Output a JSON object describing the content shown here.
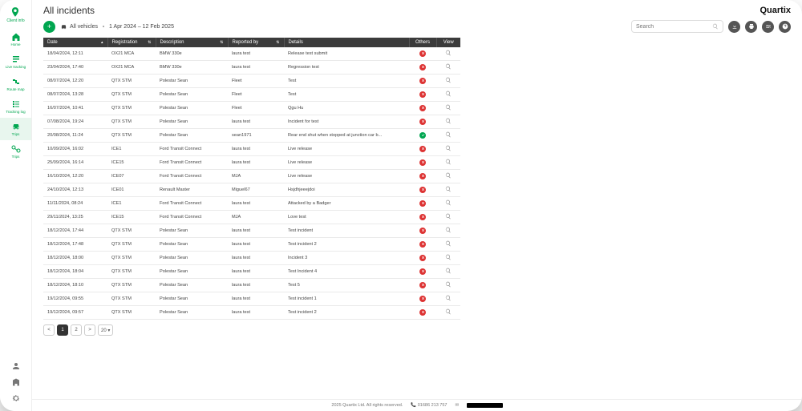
{
  "brand": "Quartix",
  "page_title": "All incidents",
  "sidebar": {
    "client_info": "Client info",
    "items": [
      {
        "label": "Home"
      },
      {
        "label": "Live tracking"
      },
      {
        "label": "Route map"
      },
      {
        "label": "Tracking log"
      },
      {
        "label": "Trips"
      },
      {
        "label": "Trips"
      }
    ]
  },
  "toolbar": {
    "vehicle_filter": "All vehicles",
    "date_range": "1 Apr 2024 – 12 Feb 2025",
    "search_placeholder": "Search"
  },
  "table": {
    "headers": {
      "date": "Date",
      "registration": "Registration",
      "description": "Description",
      "reported_by": "Reported by",
      "details": "Details",
      "others": "Others",
      "view": "View"
    },
    "rows": [
      {
        "date": "18/04/2024, 12:11",
        "reg": "OX21 MCA",
        "desc": "BMW 330e",
        "rep": "laura test",
        "det": "Release test submit",
        "status": "red"
      },
      {
        "date": "23/04/2024, 17:40",
        "reg": "OX21 MCA",
        "desc": "BMW 330e",
        "rep": "laura test",
        "det": "Regression test",
        "status": "red"
      },
      {
        "date": "08/07/2024, 12:20",
        "reg": "QTX STM",
        "desc": "Polestar Sean",
        "rep": "Fleet",
        "det": "Test",
        "status": "red"
      },
      {
        "date": "08/07/2024, 13:28",
        "reg": "QTX STM",
        "desc": "Polestar Sean",
        "rep": "Fleet",
        "det": "Test",
        "status": "red"
      },
      {
        "date": "16/07/2024, 10:41",
        "reg": "QTX STM",
        "desc": "Polestar Sean",
        "rep": "Fleet",
        "det": "Qgu Hu",
        "status": "red"
      },
      {
        "date": "07/08/2024, 19:24",
        "reg": "QTX STM",
        "desc": "Polestar Sean",
        "rep": "laura test",
        "det": "Incident for test",
        "status": "red"
      },
      {
        "date": "20/08/2024, 11:24",
        "reg": "QTX STM",
        "desc": "Polestar Sean",
        "rep": "sean1971",
        "det": "Rear end shut when stopped at junction car b...",
        "status": "green"
      },
      {
        "date": "10/09/2024, 16:02",
        "reg": "ICE1",
        "desc": "Ford Transit Connect",
        "rep": "laura test",
        "det": "Live release",
        "status": "red"
      },
      {
        "date": "25/09/2024, 16:14",
        "reg": "ICE15",
        "desc": "Ford Transit Connect",
        "rep": "laura test",
        "det": "Live release",
        "status": "red"
      },
      {
        "date": "16/10/2024, 12:20",
        "reg": "ICE07",
        "desc": "Ford Transit Connect",
        "rep": "MJA",
        "det": "Live release",
        "status": "red"
      },
      {
        "date": "24/10/2024, 12:13",
        "reg": "ICE01",
        "desc": "Renault Master",
        "rep": "Miguel67",
        "det": "Hsjdhjeeejdoi",
        "status": "red"
      },
      {
        "date": "11/11/2024, 08:24",
        "reg": "ICE1",
        "desc": "Ford Transit Connect",
        "rep": "laura test",
        "det": "Attacked by a Badger",
        "status": "red"
      },
      {
        "date": "29/11/2024, 13:25",
        "reg": "ICE15",
        "desc": "Ford Transit Connect",
        "rep": "MJA",
        "det": "Love test",
        "status": "red"
      },
      {
        "date": "18/12/2024, 17:44",
        "reg": "QTX STM",
        "desc": "Polestar Sean",
        "rep": "laura test",
        "det": "Test incident",
        "status": "red"
      },
      {
        "date": "18/12/2024, 17:48",
        "reg": "QTX STM",
        "desc": "Polestar Sean",
        "rep": "laura test",
        "det": "Test incident 2",
        "status": "red"
      },
      {
        "date": "18/12/2024, 18:00",
        "reg": "QTX STM",
        "desc": "Polestar Sean",
        "rep": "laura test",
        "det": "Incident 3",
        "status": "red"
      },
      {
        "date": "18/12/2024, 18:04",
        "reg": "QTX STM",
        "desc": "Polestar Sean",
        "rep": "laura test",
        "det": "Test Incident 4",
        "status": "red"
      },
      {
        "date": "18/12/2024, 18:10",
        "reg": "QTX STM",
        "desc": "Polestar Sean",
        "rep": "laura test",
        "det": "Test 5",
        "status": "red"
      },
      {
        "date": "19/12/2024, 09:55",
        "reg": "QTX STM",
        "desc": "Polestar Sean",
        "rep": "laura test",
        "det": "Test incident 1",
        "status": "red"
      },
      {
        "date": "19/12/2024, 09:57",
        "reg": "QTX STM",
        "desc": "Polestar Sean",
        "rep": "laura test",
        "det": "Test incident 2",
        "status": "red"
      }
    ]
  },
  "pager": {
    "prev": "<",
    "p1": "1",
    "p2": "2",
    "next": ">",
    "size": "20 ▾"
  },
  "footer": {
    "copyright": "2025 Quartix Ltd. All rights reserved.",
    "phone": "01686 213 757",
    "hidden": "hidden"
  }
}
